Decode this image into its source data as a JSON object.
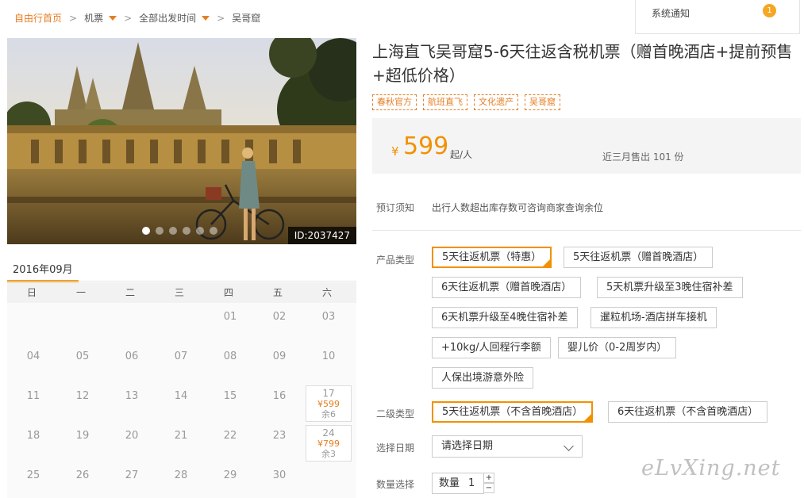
{
  "breadcrumb": {
    "home": "自由行首页",
    "items": [
      "机票",
      "全部出发时间",
      "吴哥窟"
    ]
  },
  "notice": {
    "label": "系统通知",
    "count": "1"
  },
  "hero": {
    "image_id": "ID:2037427",
    "slide_count": 6,
    "active_slide": 1
  },
  "calendar": {
    "month": "2016年09月",
    "weekdays": [
      "日",
      "一",
      "二",
      "三",
      "四",
      "五",
      "六"
    ],
    "days": [
      [
        "",
        "",
        "",
        "",
        "01",
        "02",
        "03"
      ],
      [
        "04",
        "05",
        "06",
        "07",
        "08",
        "09",
        "10"
      ],
      [
        "11",
        "12",
        "13",
        "14",
        "15",
        "16",
        "17"
      ],
      [
        "18",
        "19",
        "20",
        "21",
        "22",
        "23",
        "24"
      ],
      [
        "25",
        "26",
        "27",
        "28",
        "29",
        "30",
        ""
      ]
    ],
    "available": {
      "17": {
        "price": "¥599",
        "stock": "余6"
      },
      "24": {
        "price": "¥799",
        "stock": "余3"
      }
    }
  },
  "product": {
    "title": "上海直飞吴哥窟5-6天往返含税机票（赠首晚酒店+提前预售+超低价格）",
    "tags": [
      "春秋官方",
      "航班直飞",
      "文化遗产",
      "吴哥窟"
    ],
    "price_symbol": "¥",
    "price": "599",
    "price_unit": "起/人",
    "sold": "近三月售出 101 份"
  },
  "booking": {
    "notice_label": "预订须知",
    "notice_text": "出行人数超出库存数可咨询商家查询余位",
    "type_label": "产品类型",
    "types": [
      "5天往返机票（特惠）",
      "5天往返机票（赠首晚酒店）",
      "6天往返机票（赠首晚酒店）",
      "5天机票升级至3晚住宿补差",
      "6天机票升级至4晚住宿补差",
      "暹粒机场-酒店拼车接机",
      "+10kg/人回程行李额",
      "婴儿价（0-2周岁内）",
      "人保出境游意外险"
    ],
    "subtype_label": "二级类型",
    "subtypes": [
      "5天往返机票（不含首晚酒店）",
      "6天往返机票（不含首晚酒店）"
    ],
    "date_label": "选择日期",
    "date_placeholder": "请选择日期",
    "qty_label": "数量选择",
    "qty_prefix": "数量",
    "qty_value": "1",
    "plus": "+",
    "minus": "−"
  },
  "watermark": "eLvXing.net",
  "colors": {
    "accent": "#f29100",
    "price": "#f29100"
  }
}
